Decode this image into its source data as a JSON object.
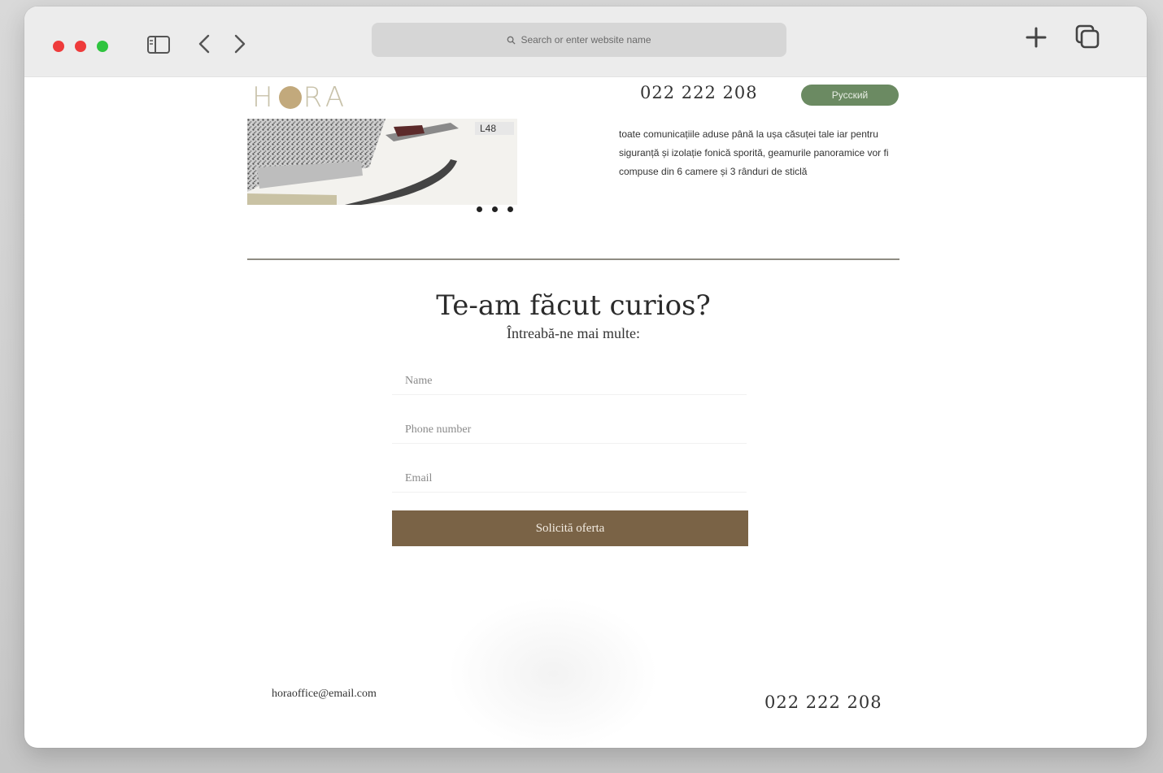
{
  "browser": {
    "address_placeholder": "Search or enter website name"
  },
  "header": {
    "logo": "HORA",
    "phone": "022 222 208",
    "language_button": "Русский"
  },
  "hero": {
    "description": "toate comunicațiile aduse până la ușa căsuței tale iar pentru siguranță și izolație fonică sporită, geamurile panoramice vor fi compuse din 6 camere și 3 rânduri de sticlă"
  },
  "contact": {
    "heading": "Te-am făcut curios?",
    "subheading": "Întreabă-ne mai multe:",
    "name_placeholder": "Name",
    "phone_placeholder": "Phone number",
    "email_placeholder": "Email",
    "submit_label": "Solicită oferta"
  },
  "footer": {
    "email": "horaoffice@email.com",
    "phone": "022 222 208"
  },
  "colors": {
    "accent_green": "#6b8a62",
    "button_brown": "#7a6346",
    "logo_gold": "#c2a97c"
  }
}
